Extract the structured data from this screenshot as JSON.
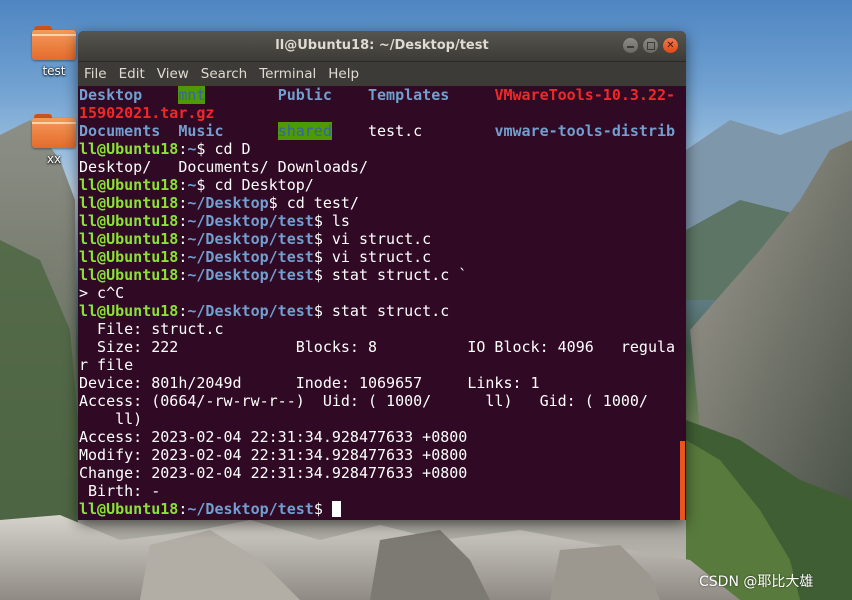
{
  "desktop": {
    "icons": [
      {
        "label": "test"
      },
      {
        "label": "xx"
      }
    ]
  },
  "window": {
    "title": "ll@Ubuntu18: ~/Desktop/test",
    "menu": [
      "File",
      "Edit",
      "View",
      "Search",
      "Terminal",
      "Help"
    ]
  },
  "terminal": {
    "lines": [
      [
        [
          "b",
          "Desktop"
        ],
        [
          "w",
          "    "
        ],
        [
          "hl",
          "mnt"
        ],
        [
          "w",
          "        "
        ],
        [
          "b",
          "Public"
        ],
        [
          "w",
          "    "
        ],
        [
          "b",
          "Templates"
        ],
        [
          "w",
          "     "
        ],
        [
          "r",
          "VMwareTools-10.3.22-"
        ]
      ],
      [
        [
          "r",
          "15902021.tar.gz"
        ]
      ],
      [
        [
          "b",
          "Documents"
        ],
        [
          "w",
          "  "
        ],
        [
          "b",
          "Music"
        ],
        [
          "w",
          "      "
        ],
        [
          "hl",
          "shared"
        ],
        [
          "w",
          "    test.c        "
        ],
        [
          "b",
          "vmware-tools-distrib"
        ]
      ],
      [
        [
          "g",
          "ll@Ubuntu18"
        ],
        [
          "w",
          ":"
        ],
        [
          "b",
          "~"
        ],
        [
          "w",
          "$ cd D"
        ]
      ],
      [
        [
          "w",
          "Desktop/   Documents/ Downloads/"
        ]
      ],
      [
        [
          "g",
          "ll@Ubuntu18"
        ],
        [
          "w",
          ":"
        ],
        [
          "b",
          "~"
        ],
        [
          "w",
          "$ cd Desktop/"
        ]
      ],
      [
        [
          "g",
          "ll@Ubuntu18"
        ],
        [
          "w",
          ":"
        ],
        [
          "b",
          "~/Desktop"
        ],
        [
          "w",
          "$ cd test/"
        ]
      ],
      [
        [
          "g",
          "ll@Ubuntu18"
        ],
        [
          "w",
          ":"
        ],
        [
          "b",
          "~/Desktop/test"
        ],
        [
          "w",
          "$ ls"
        ]
      ],
      [
        [
          "g",
          "ll@Ubuntu18"
        ],
        [
          "w",
          ":"
        ],
        [
          "b",
          "~/Desktop/test"
        ],
        [
          "w",
          "$ vi struct.c"
        ]
      ],
      [
        [
          "g",
          "ll@Ubuntu18"
        ],
        [
          "w",
          ":"
        ],
        [
          "b",
          "~/Desktop/test"
        ],
        [
          "w",
          "$ vi struct.c"
        ]
      ],
      [
        [
          "g",
          "ll@Ubuntu18"
        ],
        [
          "w",
          ":"
        ],
        [
          "b",
          "~/Desktop/test"
        ],
        [
          "w",
          "$ stat struct.c `"
        ]
      ],
      [
        [
          "w",
          "> c^C"
        ]
      ],
      [
        [
          "g",
          "ll@Ubuntu18"
        ],
        [
          "w",
          ":"
        ],
        [
          "b",
          "~/Desktop/test"
        ],
        [
          "w",
          "$ stat struct.c"
        ]
      ],
      [
        [
          "w",
          "  File: struct.c"
        ]
      ],
      [
        [
          "w",
          "  Size: 222             Blocks: 8          IO Block: 4096   regula"
        ]
      ],
      [
        [
          "w",
          "r file"
        ]
      ],
      [
        [
          "w",
          "Device: 801h/2049d      Inode: 1069657     Links: 1"
        ]
      ],
      [
        [
          "w",
          "Access: (0664/-rw-rw-r--)  Uid: ( 1000/      ll)   Gid: ( 1000/"
        ]
      ],
      [
        [
          "w",
          "    ll)"
        ]
      ],
      [
        [
          "w",
          "Access: 2023-02-04 22:31:34.928477633 +0800"
        ]
      ],
      [
        [
          "w",
          "Modify: 2023-02-04 22:31:34.928477633 +0800"
        ]
      ],
      [
        [
          "w",
          "Change: 2023-02-04 22:31:34.928477633 +0800"
        ]
      ],
      [
        [
          "w",
          " Birth: -"
        ]
      ],
      [
        [
          "g",
          "ll@Ubuntu18"
        ],
        [
          "w",
          ":"
        ],
        [
          "b",
          "~/Desktop/test"
        ],
        [
          "w",
          "$ "
        ]
      ]
    ]
  },
  "watermark": "CSDN @耶比大雄",
  "colors": {
    "terminal_bg": "#300a24",
    "prompt_user": "#8ae234",
    "directory": "#729fcf",
    "archive": "#ef2929",
    "highlight_bg": "#4e9a06",
    "accent": "#e95420"
  }
}
